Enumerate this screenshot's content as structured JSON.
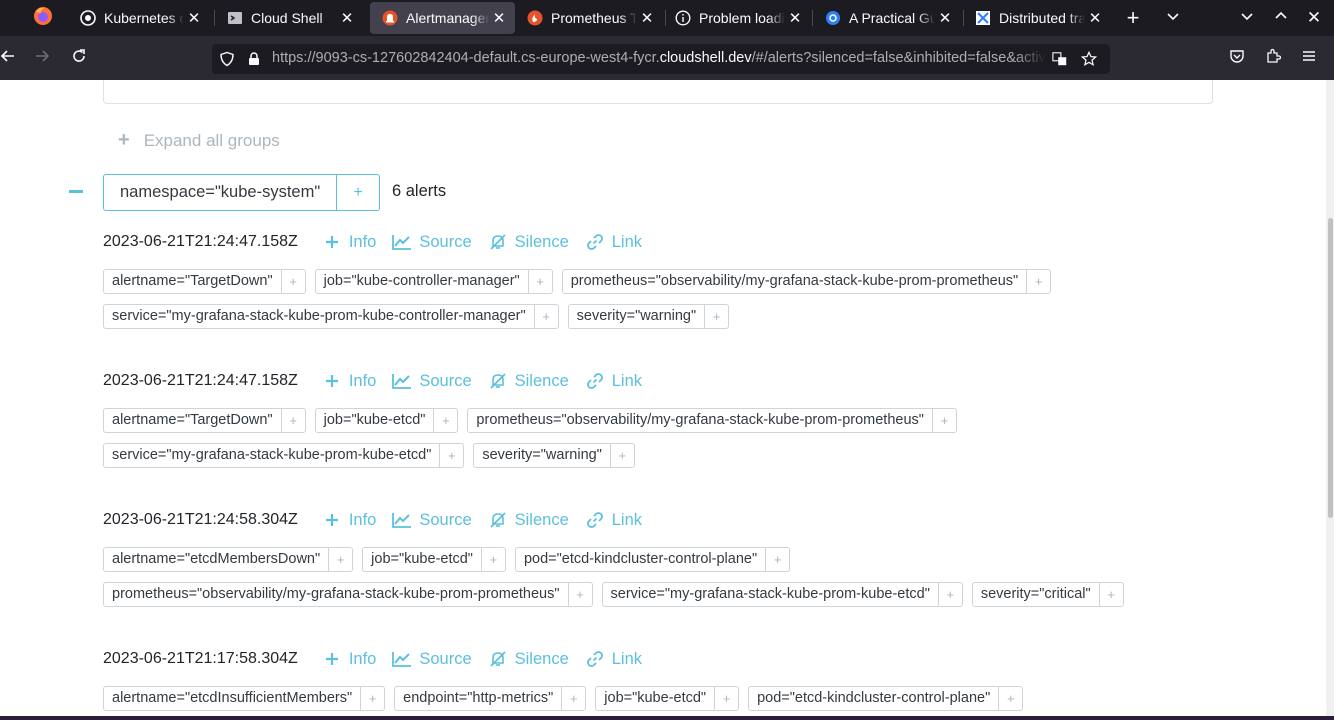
{
  "browser": {
    "tabs": [
      {
        "label": "Kubernetes cluster",
        "icon": "github-icon",
        "active": false
      },
      {
        "label": "Cloud Shell",
        "icon": "cloudshell-icon",
        "active": false
      },
      {
        "label": "Alertmanager",
        "icon": "alertmanager-icon",
        "active": true
      },
      {
        "label": "Prometheus Time Series",
        "icon": "prometheus-icon",
        "active": false
      },
      {
        "label": "Problem loading page",
        "icon": "info-icon",
        "active": false
      },
      {
        "label": "A Practical Guide",
        "icon": "blue-circle-icon",
        "active": false
      },
      {
        "label": "Distributed tracing",
        "icon": "square-logo-icon",
        "active": false
      }
    ],
    "url_prefix": "https://9093-cs-127602842404-default.cs-europe-west4-fycr.",
    "url_host": "cloudshell.dev",
    "url_suffix": "/#/alerts?silenced=false&inhibited=false&active=true"
  },
  "page": {
    "expand_all_label": "Expand all groups",
    "expand_all_icon": "+",
    "group": {
      "label": "namespace=\"kube-system\"",
      "plus": "+",
      "count": "6 alerts"
    },
    "actions": {
      "info": "Info",
      "source": "Source",
      "silence": "Silence",
      "link": "Link"
    },
    "label_plus": "+",
    "alerts": [
      {
        "timestamp": "2023-06-21T21:24:47.158Z",
        "labels": [
          "alertname=\"TargetDown\"",
          "job=\"kube-controller-manager\"",
          "prometheus=\"observability/my-grafana-stack-kube-prom-prometheus\"",
          "service=\"my-grafana-stack-kube-prom-kube-controller-manager\"",
          "severity=\"warning\""
        ]
      },
      {
        "timestamp": "2023-06-21T21:24:47.158Z",
        "labels": [
          "alertname=\"TargetDown\"",
          "job=\"kube-etcd\"",
          "prometheus=\"observability/my-grafana-stack-kube-prom-prometheus\"",
          "service=\"my-grafana-stack-kube-prom-kube-etcd\"",
          "severity=\"warning\""
        ]
      },
      {
        "timestamp": "2023-06-21T21:24:58.304Z",
        "labels": [
          "alertname=\"etcdMembersDown\"",
          "job=\"kube-etcd\"",
          "pod=\"etcd-kindcluster-control-plane\"",
          "prometheus=\"observability/my-grafana-stack-kube-prom-prometheus\"",
          "service=\"my-grafana-stack-kube-prom-kube-etcd\"",
          "severity=\"critical\""
        ]
      },
      {
        "timestamp": "2023-06-21T21:17:58.304Z",
        "labels": [
          "alertname=\"etcdInsufficientMembers\"",
          "endpoint=\"http-metrics\"",
          "job=\"kube-etcd\"",
          "pod=\"etcd-kindcluster-control-plane\""
        ]
      }
    ]
  },
  "colors": {
    "accent": "#5bc0de",
    "tabbar_bg": "#1c1b22",
    "navbar_bg": "#2b2a33"
  }
}
